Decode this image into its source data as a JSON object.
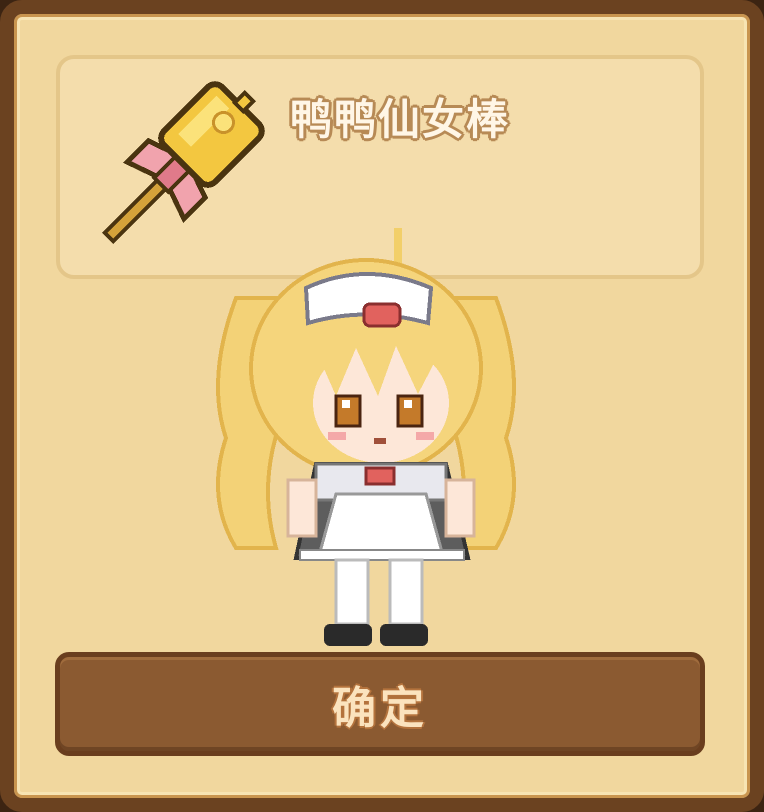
{
  "item": {
    "name": "鸭鸭仙女棒",
    "icon": "duck-fairy-wand-icon"
  },
  "character": {
    "icon": "maid-girl-character"
  },
  "confirm_button": {
    "label": "确定"
  },
  "colors": {
    "dialog_bg": "#f1d79e",
    "dialog_border": "#6b4220",
    "panel_bg": "#f4ddac",
    "button_bg": "#8b5a31",
    "button_text": "#fbe3be"
  }
}
